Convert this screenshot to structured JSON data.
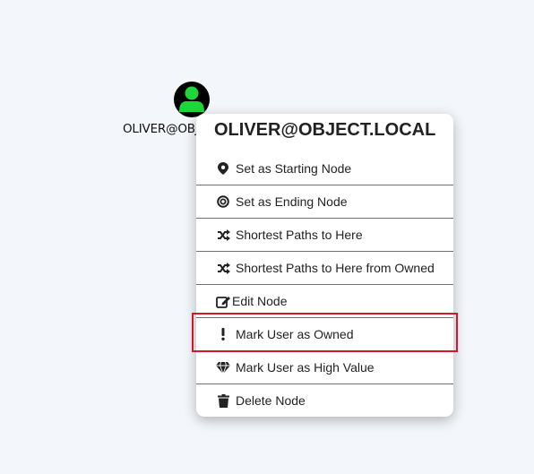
{
  "node": {
    "label": "OLIVER@OBJECT.LOCAL",
    "icon": "user-icon",
    "icon_color": "#1ed63a"
  },
  "context_menu": {
    "title": "OLIVER@OBJECT.LOCAL",
    "items": [
      {
        "label": "Set as Starting Node",
        "icon": "map-marker-icon"
      },
      {
        "label": "Set as Ending Node",
        "icon": "bullseye-icon"
      },
      {
        "label": "Shortest Paths to Here",
        "icon": "random-icon"
      },
      {
        "label": "Shortest Paths to Here from Owned",
        "icon": "random-icon"
      },
      {
        "label": "Edit Node",
        "icon": "edit-icon"
      },
      {
        "label": "Mark User as Owned",
        "icon": "exclamation-icon"
      },
      {
        "label": "Mark User as High Value",
        "icon": "gem-icon"
      },
      {
        "label": "Delete Node",
        "icon": "trash-icon"
      }
    ]
  },
  "highlight_color": "#d8162b"
}
